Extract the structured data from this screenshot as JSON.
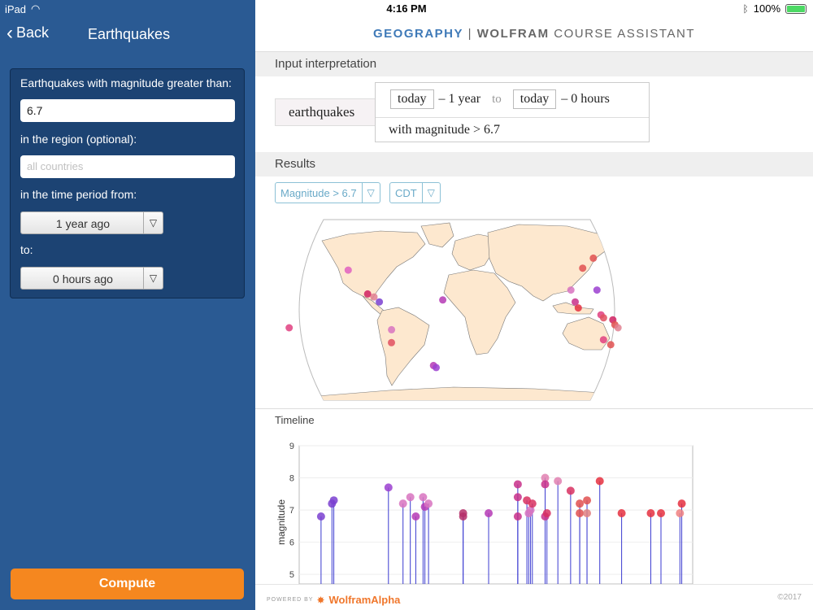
{
  "status": {
    "device": "iPad",
    "time": "4:16 PM",
    "battery_text": "100%",
    "battery_level": 1.0
  },
  "sidebar": {
    "back_label": "Back",
    "title": "Earthquakes",
    "magnitude_label": "Earthquakes with magnitude greater than:",
    "magnitude_value": "6.7",
    "region_label": "in the region (optional):",
    "region_placeholder": "all countries",
    "from_label": "in the time period from:",
    "from_value": "1 year ago",
    "to_label": "to:",
    "to_value": "0 hours ago",
    "compute_label": "Compute"
  },
  "header": {
    "geo": "GEOGRAPHY",
    "sep": "|",
    "wolfram": "WOLFRAM",
    "course": "COURSE ASSISTANT"
  },
  "interpretation": {
    "section": "Input interpretation",
    "subject": "earthquakes",
    "start_chip": "today",
    "start_offset": "– 1 year",
    "to_word": "to",
    "end_chip": "today",
    "end_offset": "– 0 hours",
    "condition": "with magnitude > 6.7"
  },
  "results": {
    "section": "Results",
    "filter_magnitude": "Magnitude > 6.7",
    "filter_tz": "CDT",
    "timeline_title": "Timeline"
  },
  "footer": {
    "powered": "POWERED BY",
    "brand": "WolframAlpha",
    "copyright": "©2017"
  },
  "icons": {
    "back": "chevron-left-icon",
    "wifi": "wifi-icon",
    "bluetooth": "bluetooth-icon",
    "dropdown": "triangle-down-icon",
    "brand": "wolfram-spikey-icon"
  },
  "colors": {
    "sidebar": "#2a5a93",
    "compute": "#f5871f",
    "accent": "#3f7ab8"
  },
  "chart_data": {
    "type": "scatter",
    "ylabel": "magnitude",
    "ylim": [
      4.7,
      9
    ],
    "yticks": [
      5,
      6,
      7,
      8,
      9
    ],
    "points": [
      {
        "x": 0.06,
        "y": 6.8,
        "c": "#7a3fd0"
      },
      {
        "x": 0.09,
        "y": 7.2,
        "c": "#7a3fd0"
      },
      {
        "x": 0.095,
        "y": 7.3,
        "c": "#7a3fd0"
      },
      {
        "x": 0.245,
        "y": 7.7,
        "c": "#9b3fd0"
      },
      {
        "x": 0.285,
        "y": 7.2,
        "c": "#d873c0"
      },
      {
        "x": 0.305,
        "y": 7.4,
        "c": "#d873c0"
      },
      {
        "x": 0.32,
        "y": 6.8,
        "c": "#b53ab5"
      },
      {
        "x": 0.34,
        "y": 7.4,
        "c": "#d873c0"
      },
      {
        "x": 0.345,
        "y": 7.1,
        "c": "#b53ab5"
      },
      {
        "x": 0.355,
        "y": 7.2,
        "c": "#d873c0"
      },
      {
        "x": 0.45,
        "y": 6.9,
        "c": "#b5306a"
      },
      {
        "x": 0.45,
        "y": 6.8,
        "c": "#b5306a"
      },
      {
        "x": 0.52,
        "y": 6.9,
        "c": "#b53ab5"
      },
      {
        "x": 0.6,
        "y": 7.8,
        "c": "#c8308a"
      },
      {
        "x": 0.6,
        "y": 7.4,
        "c": "#c8308a"
      },
      {
        "x": 0.6,
        "y": 6.8,
        "c": "#c8308a"
      },
      {
        "x": 0.625,
        "y": 7.3,
        "c": "#d83060"
      },
      {
        "x": 0.63,
        "y": 6.9,
        "c": "#d873c0"
      },
      {
        "x": 0.635,
        "y": 7.0,
        "c": "#d873c0"
      },
      {
        "x": 0.64,
        "y": 7.2,
        "c": "#d83060"
      },
      {
        "x": 0.675,
        "y": 8.0,
        "c": "#e080b0"
      },
      {
        "x": 0.675,
        "y": 7.8,
        "c": "#c8308a"
      },
      {
        "x": 0.675,
        "y": 6.8,
        "c": "#c8308a"
      },
      {
        "x": 0.68,
        "y": 6.9,
        "c": "#d83060"
      },
      {
        "x": 0.71,
        "y": 7.9,
        "c": "#e080b0"
      },
      {
        "x": 0.745,
        "y": 7.6,
        "c": "#d83060"
      },
      {
        "x": 0.77,
        "y": 7.2,
        "c": "#e05050"
      },
      {
        "x": 0.77,
        "y": 6.9,
        "c": "#e05050"
      },
      {
        "x": 0.79,
        "y": 7.3,
        "c": "#e05050"
      },
      {
        "x": 0.79,
        "y": 6.9,
        "c": "#e08080"
      },
      {
        "x": 0.825,
        "y": 7.9,
        "c": "#e53040"
      },
      {
        "x": 0.885,
        "y": 6.9,
        "c": "#e53040"
      },
      {
        "x": 0.965,
        "y": 6.9,
        "c": "#e53040"
      },
      {
        "x": 0.993,
        "y": 6.9,
        "c": "#e53040"
      },
      {
        "x": 1.05,
        "y": 7.2,
        "c": "#e53040"
      },
      {
        "x": 1.045,
        "y": 6.9,
        "c": "#f08080"
      }
    ]
  },
  "map_data": {
    "type": "map",
    "points": [
      {
        "lon": -122,
        "lat": 40,
        "c": "#e060c0"
      },
      {
        "lon": -95,
        "lat": 16,
        "c": "#d02060"
      },
      {
        "lon": -88,
        "lat": 13,
        "c": "#e08090"
      },
      {
        "lon": -82,
        "lat": 8,
        "c": "#7a3fd0"
      },
      {
        "lon": -179,
        "lat": -18,
        "c": "#e04080"
      },
      {
        "lon": -70,
        "lat": -20,
        "c": "#d873c0"
      },
      {
        "lon": -72,
        "lat": -33,
        "c": "#e05060"
      },
      {
        "lon": -28,
        "lat": -56,
        "c": "#b53ab5"
      },
      {
        "lon": -25,
        "lat": -58,
        "c": "#9b3fd0"
      },
      {
        "lon": -15,
        "lat": 10,
        "c": "#b53ab5"
      },
      {
        "lon": 142,
        "lat": 42,
        "c": "#e05050"
      },
      {
        "lon": 122,
        "lat": 20,
        "c": "#d873c0"
      },
      {
        "lon": 128,
        "lat": 2,
        "c": "#e53040"
      },
      {
        "lon": 150,
        "lat": 20,
        "c": "#9b3fd0"
      },
      {
        "lon": 160,
        "lat": 52,
        "c": "#e05050"
      },
      {
        "lon": 152,
        "lat": -5,
        "c": "#e04080"
      },
      {
        "lon": 155,
        "lat": -8,
        "c": "#e05060"
      },
      {
        "lon": 165,
        "lat": -10,
        "c": "#d02060"
      },
      {
        "lon": 168,
        "lat": -15,
        "c": "#e05050"
      },
      {
        "lon": 172,
        "lat": -18,
        "c": "#e08090"
      },
      {
        "lon": 160,
        "lat": -30,
        "c": "#e04080"
      },
      {
        "lon": 170,
        "lat": -35,
        "c": "#e05050"
      },
      {
        "lon": 125,
        "lat": 8,
        "c": "#c8308a"
      }
    ]
  }
}
